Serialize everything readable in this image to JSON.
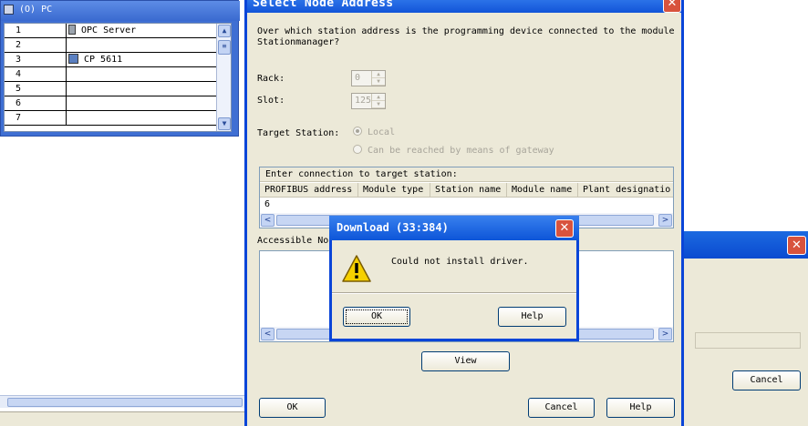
{
  "pc_window": {
    "title": "(O) PC",
    "rows": [
      {
        "num": "1",
        "name": "OPC Server",
        "icon": "opc-server-icon"
      },
      {
        "num": "2",
        "name": ""
      },
      {
        "num": "3",
        "name": "CP 5611",
        "icon": "cp-module-icon"
      },
      {
        "num": "4",
        "name": ""
      },
      {
        "num": "5",
        "name": ""
      },
      {
        "num": "6",
        "name": ""
      },
      {
        "num": "7",
        "name": ""
      }
    ]
  },
  "main_dialog": {
    "title": "Select Node Address",
    "question": "Over which station address is the programming device connected to the module Stationmanager?",
    "rack_label": "Rack:",
    "rack_value": "0",
    "slot_label": "Slot:",
    "slot_value": "125",
    "target_station_label": "Target Station:",
    "radio_local": "Local",
    "radio_gateway": "Can be reached by means of gateway",
    "connection_header": "Enter connection to target station:",
    "columns": [
      "PROFIBUS address",
      "Module type",
      "Station name",
      "Module name",
      "Plant designatio"
    ],
    "connection_value": "6",
    "accessible_label": "Accessible No",
    "view_button": "View",
    "ok_button": "OK",
    "cancel_button": "Cancel",
    "help_button": "Help"
  },
  "error_dialog": {
    "title": "Download (33:384)",
    "message": "Could not install driver.",
    "ok_button": "OK",
    "help_button": "Help",
    "icon": "warning-icon"
  },
  "right_window": {
    "cancel_button": "Cancel"
  },
  "colors": {
    "titlebar_blue": "#0a45d8",
    "close_red": "#d8533d",
    "dialog_bg": "#ece9d8"
  }
}
